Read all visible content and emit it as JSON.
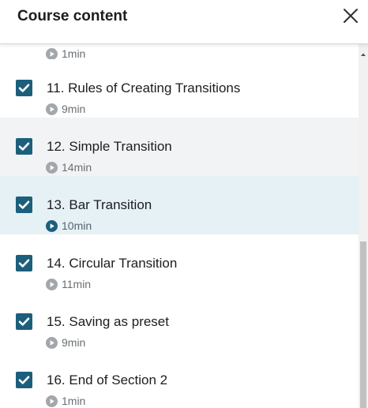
{
  "header": {
    "title": "Course content"
  },
  "items": [
    {
      "title": "",
      "duration": "1min"
    },
    {
      "title": "11. Rules of Creating Transitions",
      "duration": "9min"
    },
    {
      "title": "12. Simple Transition",
      "duration": "14min"
    },
    {
      "title": "13. Bar Transition",
      "duration": "10min"
    },
    {
      "title": "14. Circular Transition",
      "duration": "11min"
    },
    {
      "title": "15. Saving as preset",
      "duration": "9min"
    },
    {
      "title": "16. End of Section 2",
      "duration": "1min"
    }
  ],
  "icons": {
    "close": "close-icon",
    "check": "checkmark-icon",
    "play": "play-circle-icon"
  },
  "colors": {
    "checkbox": "#1c5f7c",
    "play_icon": "#a3a7ab",
    "play_icon_active": "#1c5f7c",
    "active_row": "#e5f1f5",
    "hover_row": "#f2f3f5"
  }
}
